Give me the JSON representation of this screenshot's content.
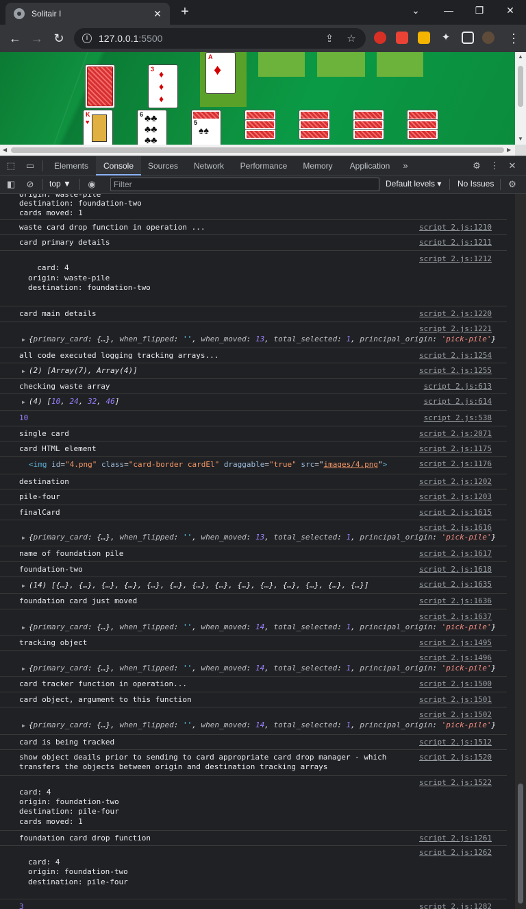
{
  "browser": {
    "tab_title": "Solitair I",
    "tab_close": "✕",
    "new_tab": "+",
    "url_host": "127.0.0.1",
    "url_port": ":5500",
    "minimize": "⌄",
    "min": "—",
    "restore": "❐",
    "close": "✕"
  },
  "game": {
    "card_a_rank": "A",
    "card_3_rank": "3",
    "card_k_rank": "K",
    "card_6_rank": "6",
    "card_5_rank": "5"
  },
  "devtools": {
    "tabs": [
      "Elements",
      "Console",
      "Sources",
      "Network",
      "Performance",
      "Memory",
      "Application"
    ],
    "context": "top ▼",
    "filter_placeholder": "Filter",
    "levels": "Default levels ▾",
    "issues": "No Issues"
  },
  "console": {
    "lines": [
      "origin: waste-pile",
      "destination: foundation-two",
      "cards moved: 1",
      "waste card drop function in operation ...",
      "card primary details",
      "  card: 4",
      "origin: waste-pile",
      "destination: foundation-two",
      "card main details",
      "all code executed logging tracking arrays...",
      "(2) [Array(7), Array(4)]",
      "checking waste array",
      "(4) [10, 24, 32, 46]",
      "10",
      "single card",
      "card HTML element",
      "destination",
      "pile-four",
      "finalCard",
      "name of foundation pile",
      "foundation-two",
      "(14) [{…}, {…}, {…}, {…}, {…}, {…}, {…}, {…}, {…}, {…}, {…}, {…}, {…}, {…}]",
      "foundation card just moved",
      "tracking object",
      "card tracker function in operation...",
      "card object, argument to this function",
      "card is being tracked",
      "show object deails prior to sending to card appropriate card drop manager - which",
      "transfers the objects between origin and destination tracking arrays",
      "card: 4",
      "origin: foundation-two",
      "destination: pile-four",
      "cards moved: 1",
      "foundation card drop function",
      "card: 4",
      "origin: foundation-two",
      "destination: pile-four",
      "3"
    ],
    "sources": [
      "script 2.js:1210",
      "script 2.js:1211",
      "script 2.js:1212",
      "script 2.js:1220",
      "script 2.js:1221",
      "script 2.js:1254",
      "script 2.js:1255",
      "script 2.js:613",
      "script 2.js:614",
      "script 2.js:538",
      "script 2.js:2071",
      "script 2.js:1175",
      "script 2.js:1176",
      "script 2.js:1202",
      "script 2.js:1203",
      "script 2.js:1615",
      "script 2.js:1616",
      "script 2.js:1617",
      "script 2.js:1618",
      "script 2.js:1635",
      "script 2.js:1636",
      "script 2.js:1637",
      "script 2.js:1495",
      "script 2.js:1496",
      "script 2.js:1500",
      "script 2.js:1501",
      "script 2.js:1502",
      "script 2.js:1512",
      "script 2.js:1520",
      "script 2.js:1522",
      "script 2.js:1261",
      "script 2.js:1262",
      "script 2.js:1282"
    ],
    "obj": {
      "k1": "primary_card",
      "v1": "{…}",
      "k2": "when_flipped",
      "v2": "''",
      "k3": "when_moved",
      "v3a": "13",
      "v3b": "14",
      "k4": "total_selected",
      "v4": "1",
      "k5": "principal_origin",
      "v5": "'pick-pile'"
    },
    "img": {
      "tag_open": "<img",
      "id_attr": "id",
      "id_val": "\"4.png\"",
      "class_attr": "class",
      "class_val": "\"card-border cardEl\"",
      "drag_attr": "draggable",
      "drag_val": "\"true\"",
      "src_attr": "src",
      "src_val": "images/4.png",
      "tag_close": ">"
    },
    "arr_nums": [
      "10",
      "24",
      "32",
      "46"
    ]
  },
  "colors": {
    "accent": "#8ab4f8",
    "felt": "#0e8c3c",
    "slot": "#6bb33a"
  }
}
